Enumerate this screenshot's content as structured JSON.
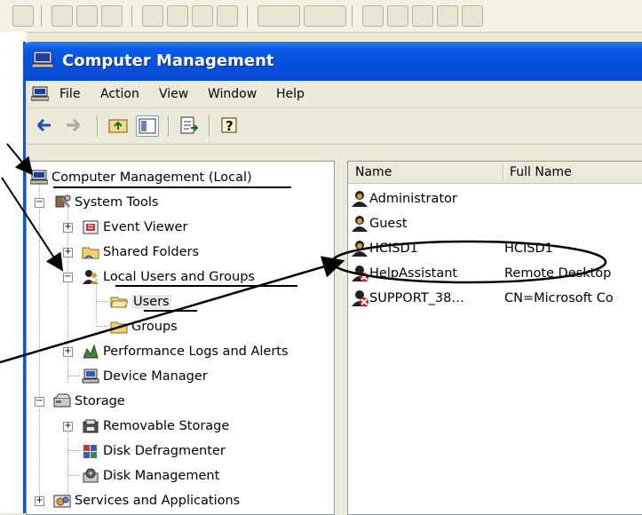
{
  "window": {
    "title": "Computer Management"
  },
  "menu": {
    "items": [
      "File",
      "Action",
      "View",
      "Window",
      "Help"
    ]
  },
  "tree": {
    "root": "Computer Management (Local)",
    "system_tools": "System Tools",
    "event_viewer": "Event Viewer",
    "shared_folders": "Shared Folders",
    "local_users_groups": "Local Users and Groups",
    "users": "Users",
    "groups": "Groups",
    "perf_logs": "Performance Logs and Alerts",
    "device_manager": "Device Manager",
    "storage": "Storage",
    "removable_storage": "Removable Storage",
    "disk_defrag": "Disk Defragmenter",
    "disk_management": "Disk Management",
    "services_apps": "Services and Applications"
  },
  "list": {
    "columns": [
      "Name",
      "Full Name"
    ],
    "rows": [
      {
        "name": "Administrator",
        "full_name": "",
        "disabled": false
      },
      {
        "name": "Guest",
        "full_name": "",
        "disabled": false
      },
      {
        "name": "HCISD1",
        "full_name": "HCISD1",
        "disabled": false
      },
      {
        "name": "HelpAssistant",
        "full_name": "Remote Desktop",
        "disabled": true
      },
      {
        "name": "SUPPORT_38…",
        "full_name": "CN=Microsoft Co",
        "disabled": true
      }
    ]
  },
  "colors": {
    "titlebar": "#0550dc",
    "annotation": "#000000"
  }
}
